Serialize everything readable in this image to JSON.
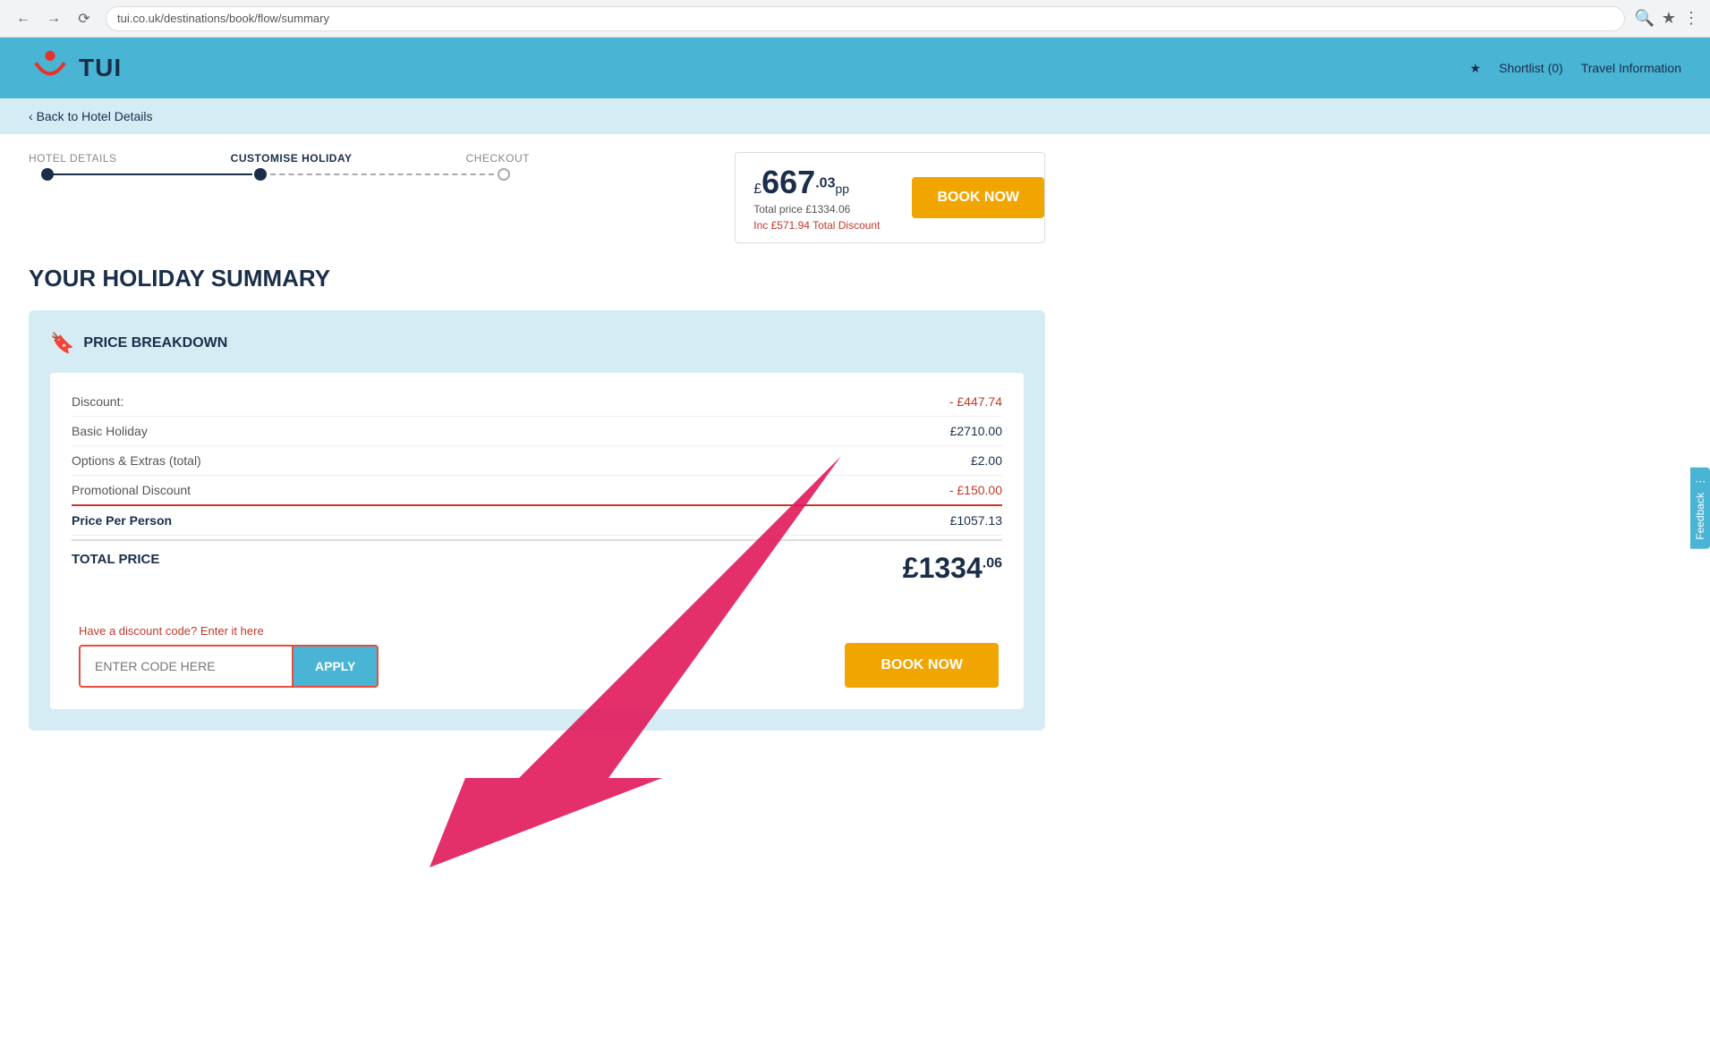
{
  "browser": {
    "url": "tui.co.uk/destinations/book/flow/summary"
  },
  "header": {
    "logo_text": "TUI",
    "nav_shortlist": "Shortlist (0)",
    "nav_travel": "Travel Information"
  },
  "sub_header": {
    "back_link": "Back to Hotel Details"
  },
  "stepper": {
    "steps": [
      {
        "label": "HOTEL DETAILS",
        "state": "completed"
      },
      {
        "label": "CUSTOMISE HOLIDAY",
        "state": "active"
      },
      {
        "label": "CHECKOUT",
        "state": "pending"
      }
    ]
  },
  "price_header": {
    "currency": "£",
    "big": "667",
    "cents": ".03",
    "pp": "pp",
    "total_label": "Total price £1334.06",
    "discount_label": "Inc £571.94 Total Discount",
    "book_now": "BOOK NOW"
  },
  "page": {
    "title": "YOUR HOLIDAY SUMMARY"
  },
  "price_breakdown": {
    "section_title": "PRICE BREAKDOWN",
    "rows": [
      {
        "label": "Discount:",
        "value": "- £447.74",
        "type": "negative"
      },
      {
        "label": "Basic Holiday",
        "value": "£2710.00",
        "type": "normal"
      },
      {
        "label": "Options & Extras (total)",
        "value": "£2.00",
        "type": "normal"
      },
      {
        "label": "Promotional Discount",
        "value": "- £150.00",
        "type": "promo"
      }
    ],
    "per_person_label": "Price Per Person",
    "per_person_value": "£1057.13",
    "total_label": "TOTAL PRICE",
    "total_big": "1334",
    "total_cents": ".06"
  },
  "discount_code": {
    "label": "Have a discount code? Enter it here",
    "placeholder": "ENTER CODE HERE",
    "apply_label": "APPLY",
    "book_now_label": "BOOK NOW"
  },
  "feedback": {
    "label": "Feedback"
  }
}
